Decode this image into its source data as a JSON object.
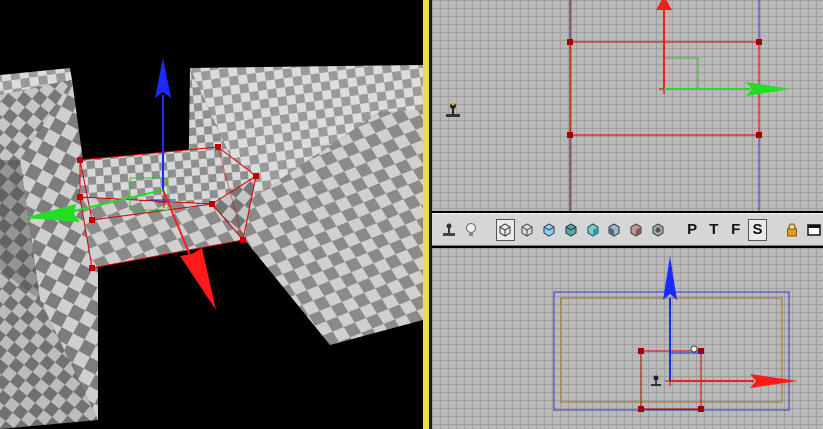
{
  "toolbar": {
    "left_tools": [
      {
        "name": "brush-builder-icon",
        "label": ""
      },
      {
        "name": "light-bulb-icon",
        "label": ""
      }
    ],
    "view_modes": [
      {
        "name": "wireframe-view-icon",
        "active": true
      },
      {
        "name": "brush-wire-view-icon",
        "active": false
      },
      {
        "name": "zone-view-icon",
        "active": false
      },
      {
        "name": "bsp-view-icon",
        "active": false
      },
      {
        "name": "texture-view-icon",
        "active": false
      },
      {
        "name": "lighting-view-icon",
        "active": false
      },
      {
        "name": "unlit-view-icon",
        "active": false
      },
      {
        "name": "depth-view-icon",
        "active": false
      }
    ],
    "ortho_buttons": [
      {
        "name": "perspective-button",
        "label": "P",
        "active": false
      },
      {
        "name": "top-view-button",
        "label": "T",
        "active": false
      },
      {
        "name": "front-view-button",
        "label": "F",
        "active": false
      },
      {
        "name": "side-view-button",
        "label": "S",
        "active": true
      }
    ],
    "right_tools": [
      {
        "name": "lock-icon"
      },
      {
        "name": "maximize-viewport-icon"
      }
    ]
  },
  "colors": {
    "divider": "#e8e04a",
    "selection": "#d40000",
    "axis_x": "#ff1a1a",
    "axis_y": "#22dd22",
    "axis_z": "#1a2bff",
    "grid_bg": "#b9b9b9",
    "brush_outline": "#a07020",
    "builder_outline": "#3333cc"
  }
}
